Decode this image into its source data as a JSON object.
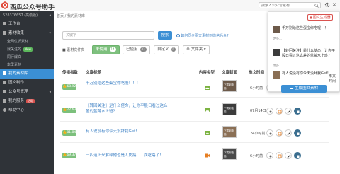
{
  "app": {
    "brand": "西瓜公众号助手",
    "search_placeholder": "搜索人公众号素材",
    "close_glyph": "✕"
  },
  "sidebar": {
    "user": "528376657 (高级版)",
    "items": [
      {
        "label": "工作台"
      },
      {
        "label": "素材收集"
      },
      {
        "label": "全网优质素材"
      },
      {
        "label": "我关注的",
        "badge": "New"
      },
      {
        "label": "同行爆文"
      },
      {
        "label": "本里素材"
      },
      {
        "label": "我的素材库"
      },
      {
        "label": "图文制作"
      },
      {
        "label": "公众号管理"
      },
      {
        "label": "我的服务",
        "badge": "活动"
      },
      {
        "label": "帮助中心"
      }
    ]
  },
  "breadcrumb": "首页 / 我的素材库",
  "toolbar": {
    "search_placeholder": "关键字",
    "search_btn": "搜索",
    "help_link": "如何同步图文素材到微信后台?",
    "folder_label": "素材文件夹",
    "filters": [
      {
        "label": "未使用",
        "count": "14"
      },
      {
        "label": "已使用",
        "count": "43"
      },
      {
        "label": "自定义",
        "count": "0"
      },
      {
        "label": "文件夹 ▾",
        "count": ""
      }
    ]
  },
  "table": {
    "headers": [
      "传播指数",
      "文章标题",
      "内容类型",
      "文章封面",
      "推文时间"
    ],
    "rows": [
      {
        "score": "68.92",
        "title": "千万别给这些蛋宝你吃喔！！！",
        "thumb_caption": "下载到电脑",
        "time": "6小时前"
      },
      {
        "score": "72.63",
        "title": "【转回关注】是什么使命，让你平股日看过这么差的蓝莓水上班？",
        "thumb_caption": "下载到电脑",
        "time": "07月14日"
      },
      {
        "score": "81.84",
        "title": "有人说没有你今天没拜我Get!",
        "thumb_caption": "下载到电脑",
        "time": "24小时前"
      },
      {
        "score": "69.37",
        "title": "三四道上来解释他也是入肉搞......次吃咯了！",
        "thumb_caption": "下载到电脑",
        "time": "6小时前"
      }
    ]
  },
  "popup": {
    "header": "图文生成器",
    "items": [
      {
        "text": "千万别给这些蛋宝你吃喔！！！",
        "more": "更多..."
      },
      {
        "text": "【转回关注】是什么使命，让你平股日看过这么差的蓝莓水上班？",
        "more": "更多..."
      },
      {
        "text": "有人说没有你今天没拜我Get!",
        "more": ""
      }
    ],
    "generate_btn": "生成图文素材"
  },
  "side_note": "推文时间"
}
